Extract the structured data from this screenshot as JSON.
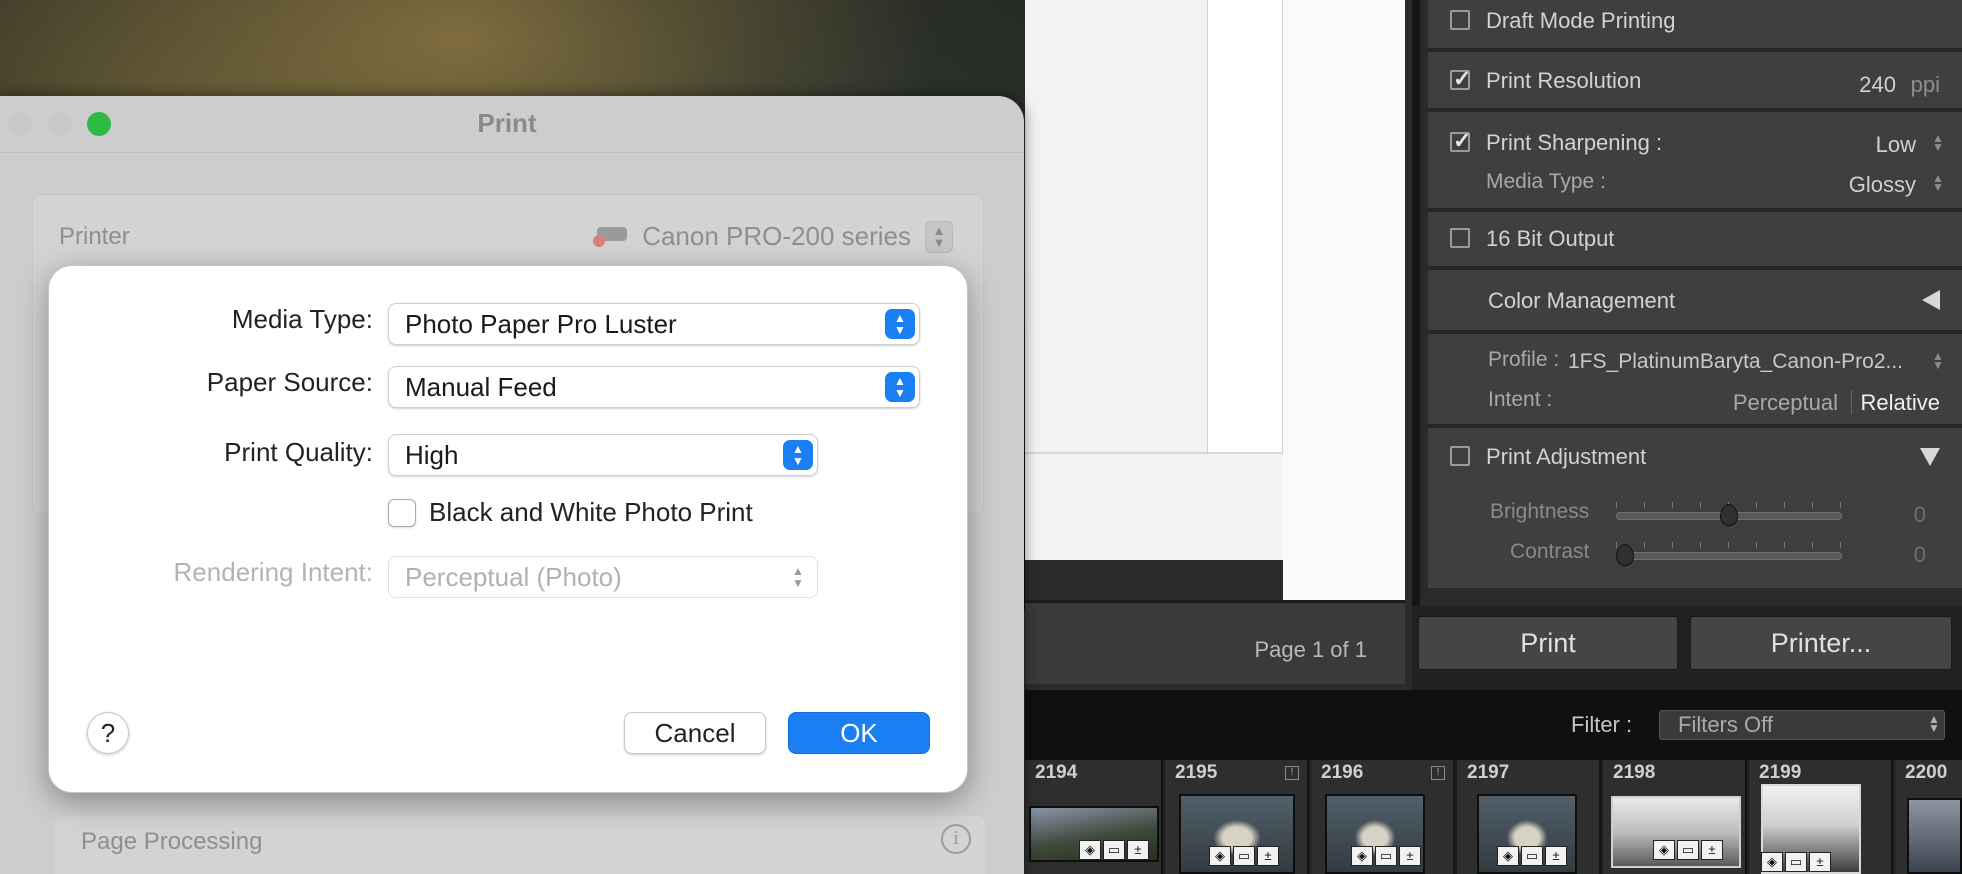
{
  "lightroom": {
    "page_count": "Page 1 of 1",
    "panel": {
      "draft_mode": {
        "label": "Draft Mode Printing",
        "checked": false
      },
      "print_resolution": {
        "label": "Print Resolution",
        "value": "240",
        "unit": "ppi",
        "checked": true
      },
      "print_sharpening": {
        "label": "Print Sharpening :",
        "value": "Low",
        "checked": true
      },
      "media_type": {
        "label": "Media Type :",
        "value": "Glossy"
      },
      "bit_output": {
        "label": "16 Bit Output",
        "checked": false
      },
      "color_management": {
        "label": "Color Management"
      },
      "profile": {
        "label": "Profile :",
        "value": "1FS_PlatinumBaryta_Canon-Pro2..."
      },
      "intent": {
        "label": "Intent :",
        "option_a": "Perceptual",
        "option_b": "Relative"
      },
      "print_adjustment": {
        "label": "Print Adjustment",
        "checked": false
      },
      "brightness": {
        "label": "Brightness",
        "value": "0",
        "level": 0.5
      },
      "contrast": {
        "label": "Contrast",
        "value": "0",
        "level": 0.0
      }
    },
    "buttons": {
      "print": "Print",
      "printer": "Printer..."
    },
    "filter": {
      "label": "Filter :",
      "value": "Filters Off"
    },
    "filmstrip": [
      "2194",
      "2195",
      "2196",
      "2197",
      "2198",
      "2199",
      "2200"
    ]
  },
  "print_window": {
    "title": "Print",
    "printer_label": "Printer",
    "printer_value": "Canon PRO-200 series",
    "page_processing": "Page Processing"
  },
  "dialog": {
    "media_type": {
      "label": "Media Type:",
      "value": "Photo Paper Pro Luster"
    },
    "paper_source": {
      "label": "Paper Source:",
      "value": "Manual Feed"
    },
    "print_quality": {
      "label": "Print Quality:",
      "value": "High"
    },
    "bw_print": {
      "label": "Black and White Photo Print",
      "checked": false
    },
    "rendering_intent": {
      "label": "Rendering Intent:",
      "value": "Perceptual (Photo)"
    },
    "help": "?",
    "cancel": "Cancel",
    "ok": "OK"
  },
  "colors": {
    "accent": "#1a7ff2",
    "traffic_light_close": "#c9c9c9",
    "traffic_light_minimize": "#c9c9c9",
    "traffic_light_zoom": "#2dbb45"
  }
}
